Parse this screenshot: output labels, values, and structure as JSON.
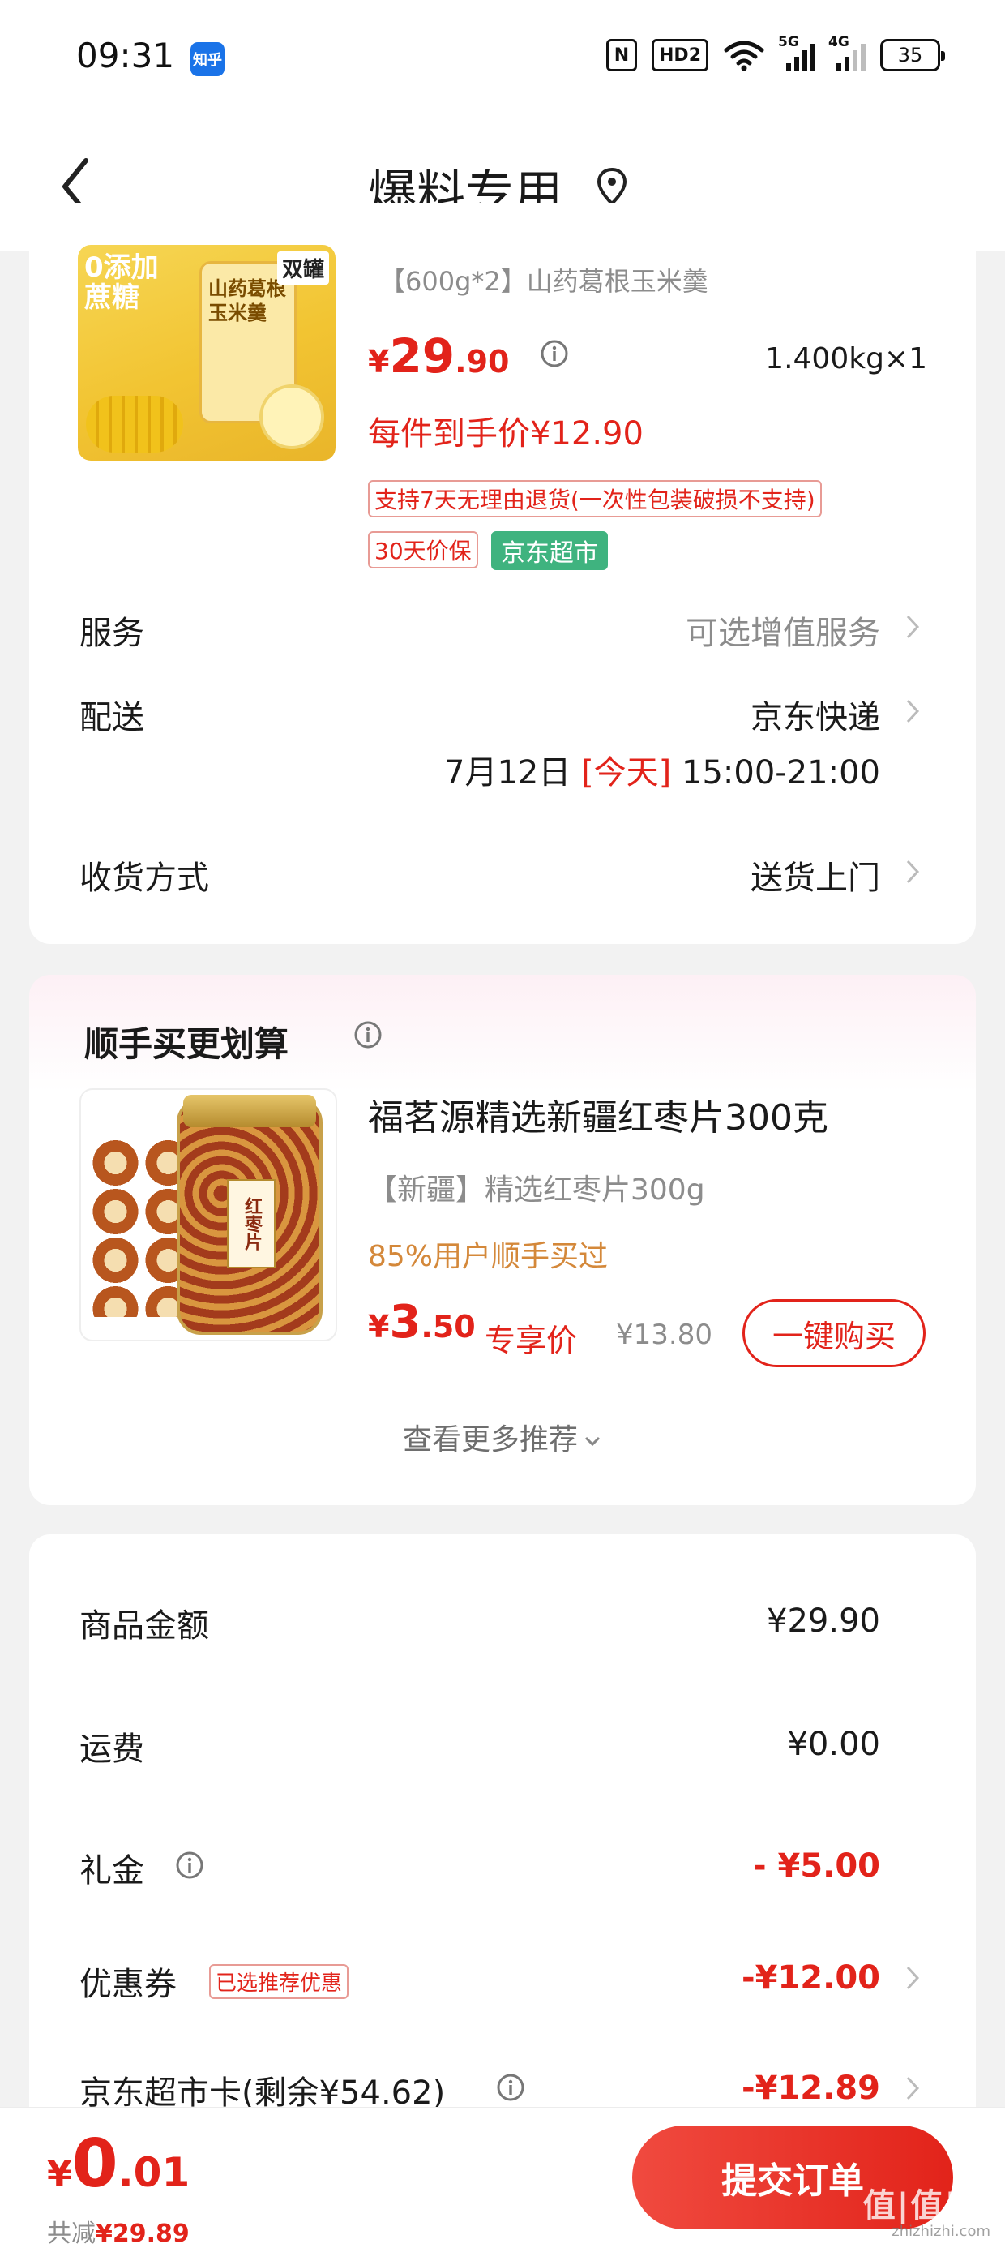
{
  "status_bar": {
    "time": "09:31",
    "app_badge": "知乎",
    "nfc": "N",
    "hd": "HD2",
    "signal1": "5G",
    "signal2": "4G",
    "battery": "35"
  },
  "nav": {
    "title": "爆料专用",
    "icons": [
      "back-icon",
      "location-pin-icon"
    ]
  },
  "product": {
    "image_text": {
      "badge": "0添加\n蔗糖",
      "jar_label": "山药葛根\n玉米羹",
      "double": "双罐"
    },
    "spec": "【600g*2】山药葛根玉米羹",
    "price_cur": "¥",
    "price_int": "29",
    "price_dec": ".90",
    "quantity": "1.400kg×1",
    "final_price": "每件到手价¥12.90",
    "tags": {
      "return_policy": "支持7天无理由退货(一次性包装破损不支持)",
      "price_protect": "30天价保",
      "store": "京东超市"
    }
  },
  "rows": {
    "service": {
      "label": "服务",
      "value": "可选增值服务"
    },
    "delivery": {
      "label": "配送",
      "value": "京东快递",
      "date": "7月12日",
      "today": "[今天]",
      "time": "15:00-21:00"
    },
    "receive": {
      "label": "收货方式",
      "value": "送货上门"
    }
  },
  "recommend": {
    "title": "顺手买更划算",
    "product": {
      "image_label": "红枣片",
      "name": "福茗源精选新疆红枣片300克",
      "spec": "【新疆】精选红枣片300g",
      "bought": "85%用户顺手买过",
      "price_cur": "¥",
      "price_int": "3",
      "price_dec": ".50",
      "exclusive": "专享价",
      "original": "¥13.80",
      "buy_label": "一键购买"
    },
    "more": "查看更多推荐"
  },
  "summary": {
    "goods": {
      "label": "商品金额",
      "value": "¥29.90"
    },
    "shipping": {
      "label": "运费",
      "value": "¥0.00"
    },
    "gift": {
      "label": "礼金",
      "value": "- ¥5.00"
    },
    "coupon": {
      "label": "优惠券",
      "tag": "已选推荐优惠",
      "value": "-¥12.00"
    },
    "card": {
      "label": "京东超市卡(剩余¥54.62)",
      "value": "-¥12.89"
    }
  },
  "bottom": {
    "total_cur": "¥",
    "total_int": "0",
    "total_dec": ".01",
    "saved_label": "共减",
    "saved_amount": "¥29.89",
    "submit_label": "提交订单",
    "watermark": "值|值|值",
    "watermark_sub": "zhizhizhi.com"
  },
  "colors": {
    "accent": "#e2231a",
    "store_badge": "#3fb37f",
    "bought_text": "#d4883a",
    "page_bg": "#f2f2f2"
  }
}
